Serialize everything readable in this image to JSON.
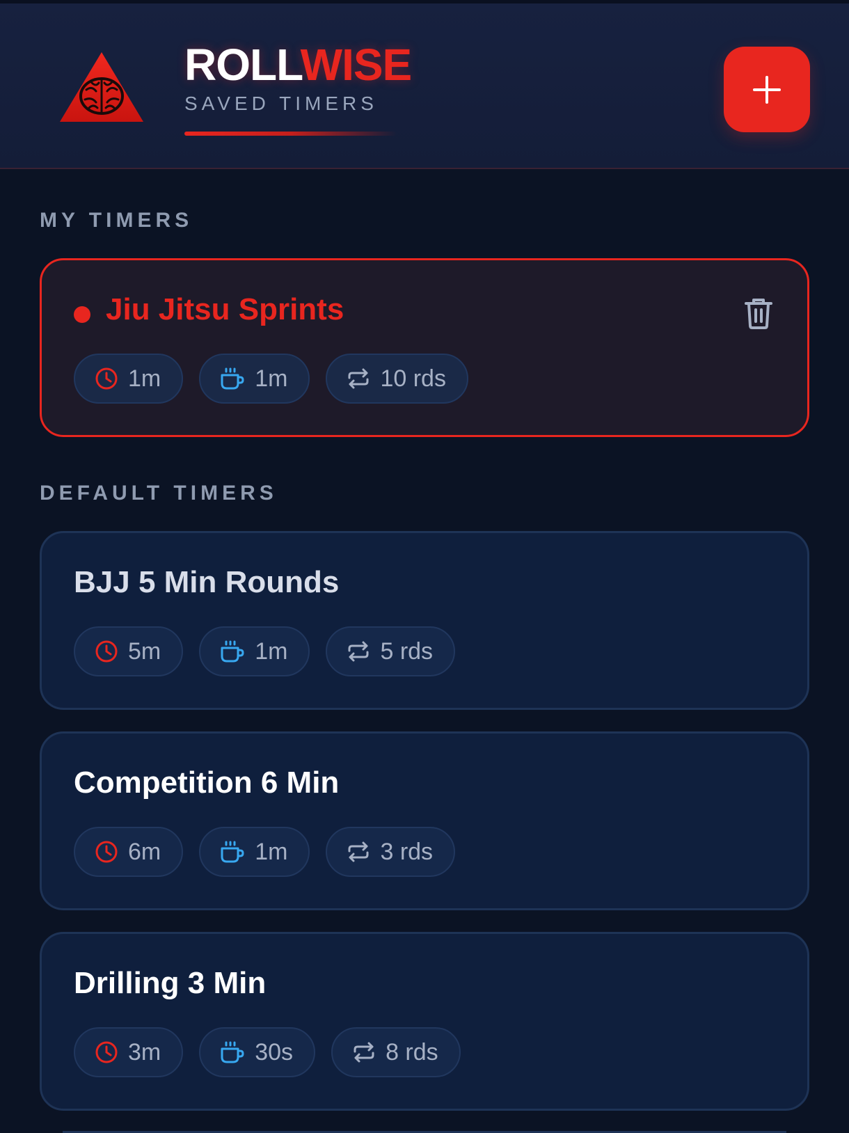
{
  "app": {
    "brand_part1": "ROLL",
    "brand_part2": "WISE",
    "subtitle": "SAVED TIMERS",
    "accent_color": "#e8261f"
  },
  "header": {
    "logo_icon": "brain-triangle-logo",
    "add_button_icon": "plus-icon"
  },
  "sections": {
    "my_timers_label": "MY TIMERS",
    "default_timers_label": "DEFAULT TIMERS"
  },
  "my_timers": [
    {
      "name": "Jiu Jitsu Sprints",
      "round": "1m",
      "rest": "1m",
      "rounds": "10 rds",
      "active": true
    }
  ],
  "default_timers": [
    {
      "name": "BJJ 5 Min Rounds",
      "round": "5m",
      "rest": "1m",
      "rounds": "5 rds"
    },
    {
      "name": "Competition 6 Min",
      "round": "6m",
      "rest": "1m",
      "rounds": "3 rds"
    },
    {
      "name": "Drilling 3 Min",
      "round": "3m",
      "rest": "30s",
      "rounds": "8 rds"
    }
  ],
  "icons": {
    "round": "clock-icon",
    "rest": "coffee-cup-icon",
    "rounds": "repeat-icon",
    "delete": "trash-icon"
  }
}
